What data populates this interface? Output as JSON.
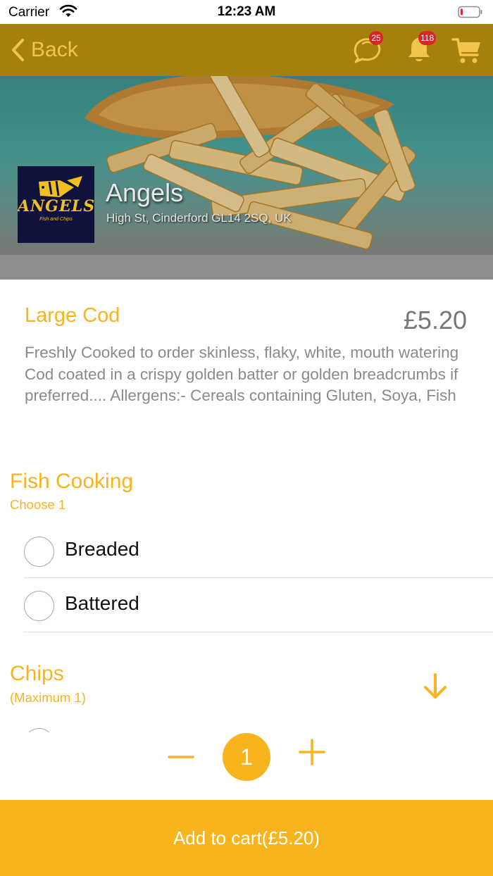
{
  "status_bar": {
    "carrier": "Carrier",
    "time": "12:23 AM"
  },
  "nav": {
    "back_label": "Back",
    "chat_badge": "25",
    "notification_badge": "118",
    "icons": [
      "back-chevron-icon",
      "chat-icon",
      "bell-icon",
      "cart-icon"
    ]
  },
  "restaurant": {
    "name": "Angels",
    "address": "High St, Cinderford GL14 2SQ, UK",
    "logo_text": "ANGELS",
    "logo_subtext": "Fish and Chips"
  },
  "product": {
    "name": "Large Cod",
    "price": "£5.20",
    "description": "Freshly Cooked to order skinless, flaky, white, mouth watering Cod coated in a crispy golden batter or golden breadcrumbs if preferred.... Allergens:- Cereals containing Gluten, Soya, Fish"
  },
  "option_groups": [
    {
      "title": "Fish Cooking",
      "subtitle": "Choose 1",
      "options": [
        {
          "label": "Breaded",
          "selected": false
        },
        {
          "label": "Battered",
          "selected": false
        }
      ]
    },
    {
      "title": "Chips",
      "subtitle": "(Maximum 1)",
      "options": []
    }
  ],
  "quantity": {
    "value": "1"
  },
  "cart_button": {
    "label": "Add to cart(£5.20)"
  },
  "colors": {
    "accent": "#f7b41d",
    "nav_background": "#a5800d",
    "nav_foreground": "#f2c44b",
    "badge": "#d9252a",
    "description_text": "#8a8a8a",
    "price_text": "#777777"
  }
}
